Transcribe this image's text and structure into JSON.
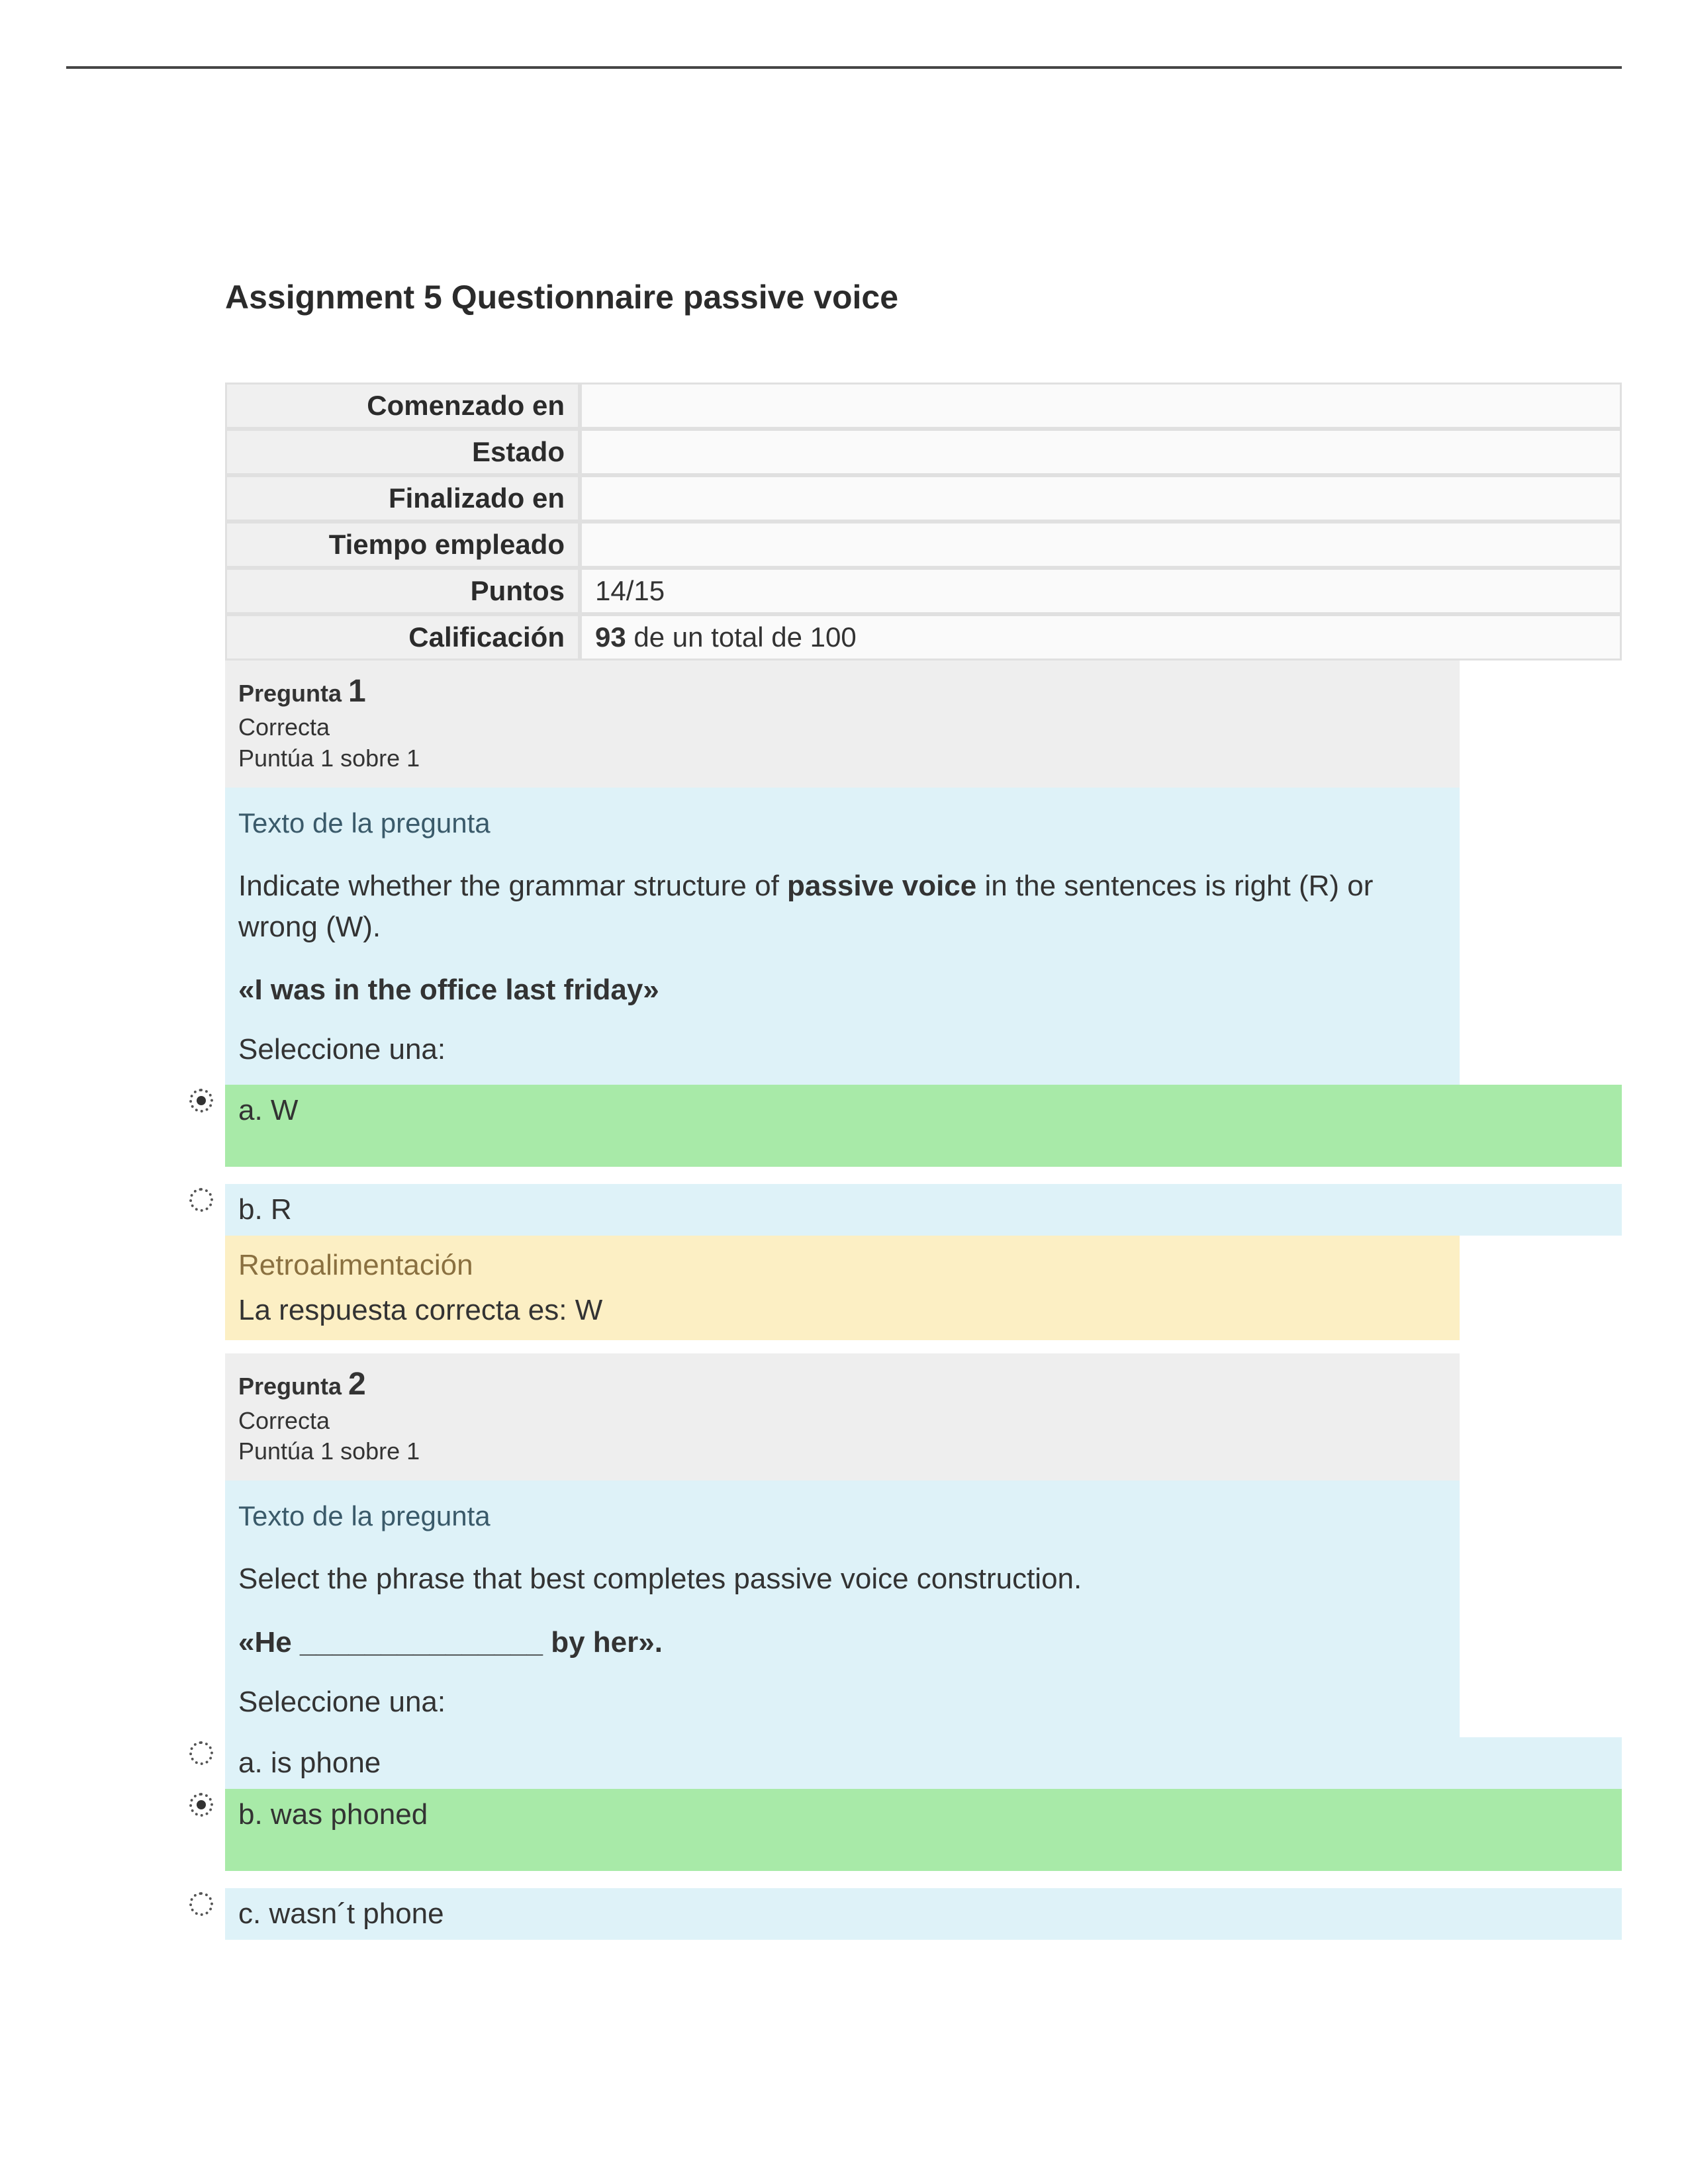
{
  "title": "Assignment 5 Questionnaire passive voice",
  "summary": {
    "rows": [
      {
        "label": "Comenzado en",
        "value": ""
      },
      {
        "label": "Estado",
        "value": ""
      },
      {
        "label": "Finalizado en",
        "value": ""
      },
      {
        "label": "Tiempo empleado",
        "value": ""
      },
      {
        "label": "Puntos",
        "value": "14/15"
      }
    ],
    "grade_label": "Calificación",
    "grade_score": "93",
    "grade_rest": " de un total de 100"
  },
  "labels": {
    "pregunta": "Pregunta ",
    "texto_de_la_pregunta": "Texto de la pregunta",
    "seleccione_una": "Seleccione una:",
    "retroalimentacion": "Retroalimentación",
    "respuesta_correcta": "La respuesta correcta es: "
  },
  "q1": {
    "number": "1",
    "status": "Correcta",
    "score": "Puntúa 1 sobre 1",
    "prompt_pre": "Indicate whether the grammar structure of ",
    "prompt_bold": "passive voice",
    "prompt_post": " in the sentences is right (R) or wrong (W).",
    "sentence": "«I was in the office last friday»",
    "options": {
      "a": "a. W",
      "b": "b. R"
    },
    "correct_answer": "W"
  },
  "q2": {
    "number": "2",
    "status": "Correcta",
    "score": "Puntúa 1 sobre 1",
    "prompt": "Select the phrase that best completes passive voice construction.",
    "sentence": "«He _______________ by her».",
    "options": {
      "a": "a. is phone",
      "b": "b. was phoned",
      "c": "c. wasn´t phone"
    }
  }
}
